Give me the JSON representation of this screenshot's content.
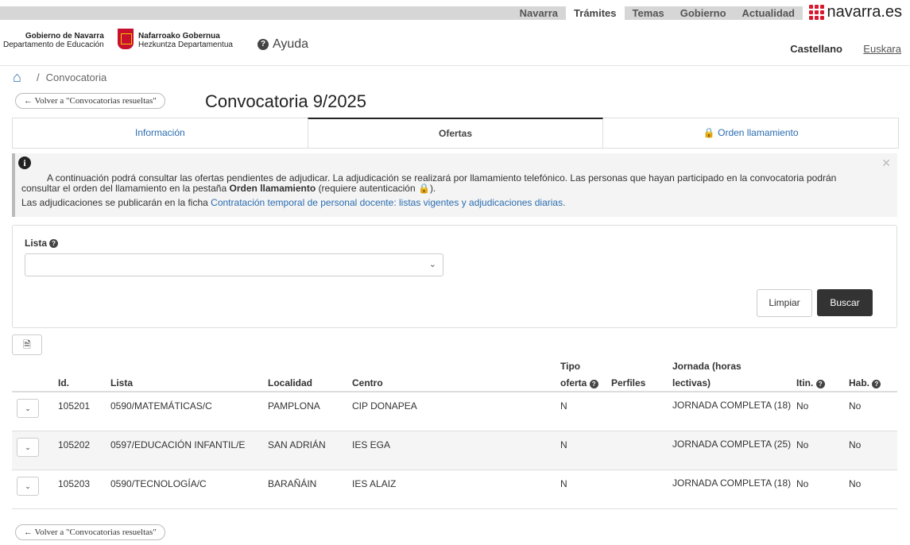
{
  "topnav": [
    "Navarra",
    "Trámites",
    "Temas",
    "Gobierno",
    "Actualidad"
  ],
  "brand": "navarra.es",
  "header": {
    "logo_left_line1": "Gobierno de Navarra",
    "logo_left_line2": "Departamento de Educación",
    "logo_right_line1": "Nafarroako Gobernua",
    "logo_right_line2": "Hezkuntza Departamentua",
    "ayuda": "Ayuda",
    "lang_active": "Castellano",
    "lang_other": "Euskara"
  },
  "breadcrumb": "Convocatoria",
  "back_label": "← Volver a \"Convocatorias resueltas\"",
  "title": "Convocatoria 9/2025",
  "tabs": [
    {
      "label": "Información"
    },
    {
      "label": "Ofertas"
    },
    {
      "label": "Orden llamamiento"
    }
  ],
  "alert": {
    "p1_a": "A continuación podrá consultar las ofertas pendientes de adjudicar. La adjudicación se realizará por llamamiento telefónico. Las personas que hayan participado en la convocatoria podrán consultar el orden del llamamiento en la pestaña",
    "p1_bold": "Orden llamamiento",
    "p1_c": "(requiere autenticación",
    "p1_d": ").",
    "p2_a": "Las adjudicaciones se publicarán en la ficha",
    "p2_link": "Contratación temporal de personal docente: listas vigentes y adjudicaciones diarias."
  },
  "filter": {
    "label": "Lista",
    "limpiar": "Limpiar",
    "buscar": "Buscar"
  },
  "table": {
    "headers": {
      "id": "Id.",
      "lista": "Lista",
      "localidad": "Localidad",
      "centro": "Centro",
      "tipo1": "Tipo",
      "tipo2": "oferta",
      "perfiles": "Perfiles",
      "jornada1": "Jornada (horas",
      "jornada2": "lectivas)",
      "itin": "Itin.",
      "hab": "Hab."
    },
    "rows": [
      {
        "id": "105201",
        "lista": "0590/MATEMÁTICAS/C",
        "localidad": "PAMPLONA",
        "centro": "CIP DONAPEA",
        "tipo": "N",
        "jornada": "JORNADA COMPLETA (18)",
        "itin": "No",
        "hab": "No"
      },
      {
        "id": "105202",
        "lista": "0597/EDUCACIÓN INFANTIL/E",
        "localidad": "SAN ADRIÁN",
        "centro": "IES EGA",
        "tipo": "N",
        "jornada": "JORNADA COMPLETA (25)",
        "itin": "No",
        "hab": "No"
      },
      {
        "id": "105203",
        "lista": "0590/TECNOLOGÍA/C",
        "localidad": "BARAÑÁIN",
        "centro": "IES ALAIZ",
        "tipo": "N",
        "jornada": "JORNADA COMPLETA (18)",
        "itin": "No",
        "hab": "No"
      }
    ]
  }
}
